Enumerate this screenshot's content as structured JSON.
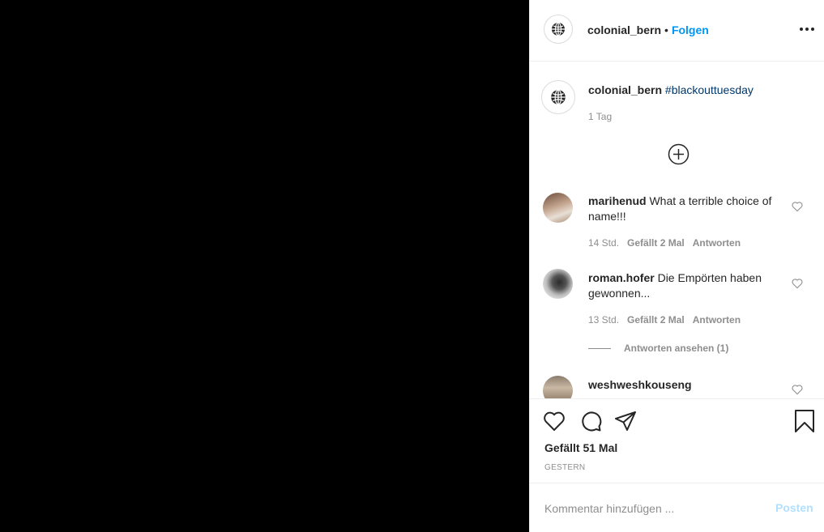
{
  "post": {
    "username": "colonial_bern",
    "dot": "•",
    "follow_label": "Folgen"
  },
  "caption": {
    "username": "colonial_bern",
    "hashtag": "#blackouttuesday",
    "time": "1 Tag"
  },
  "comments": [
    {
      "username": "marihenud",
      "text": "What a terrible choice of name!!!",
      "time": "14 Std.",
      "likes": "Gefällt 2 Mal",
      "reply": "Antworten"
    },
    {
      "username": "roman.hofer",
      "text": "Die Empörten haben gewonnen...",
      "time": "13 Std.",
      "likes": "Gefällt 2 Mal",
      "reply": "Antworten",
      "view_replies": "Antworten ansehen (1)"
    },
    {
      "username": "weshweshkouseng",
      "text": ""
    }
  ],
  "actions": {
    "likes_label": "Gefällt 51 Mal",
    "date": "GESTERN"
  },
  "add_comment": {
    "placeholder": "Kommentar hinzufügen ...",
    "post_label": "Posten"
  },
  "colors": {
    "accent": "#0095f6",
    "hashtag": "#00376b",
    "muted": "#8e8e8e",
    "post_disabled": "#b2dffc"
  }
}
